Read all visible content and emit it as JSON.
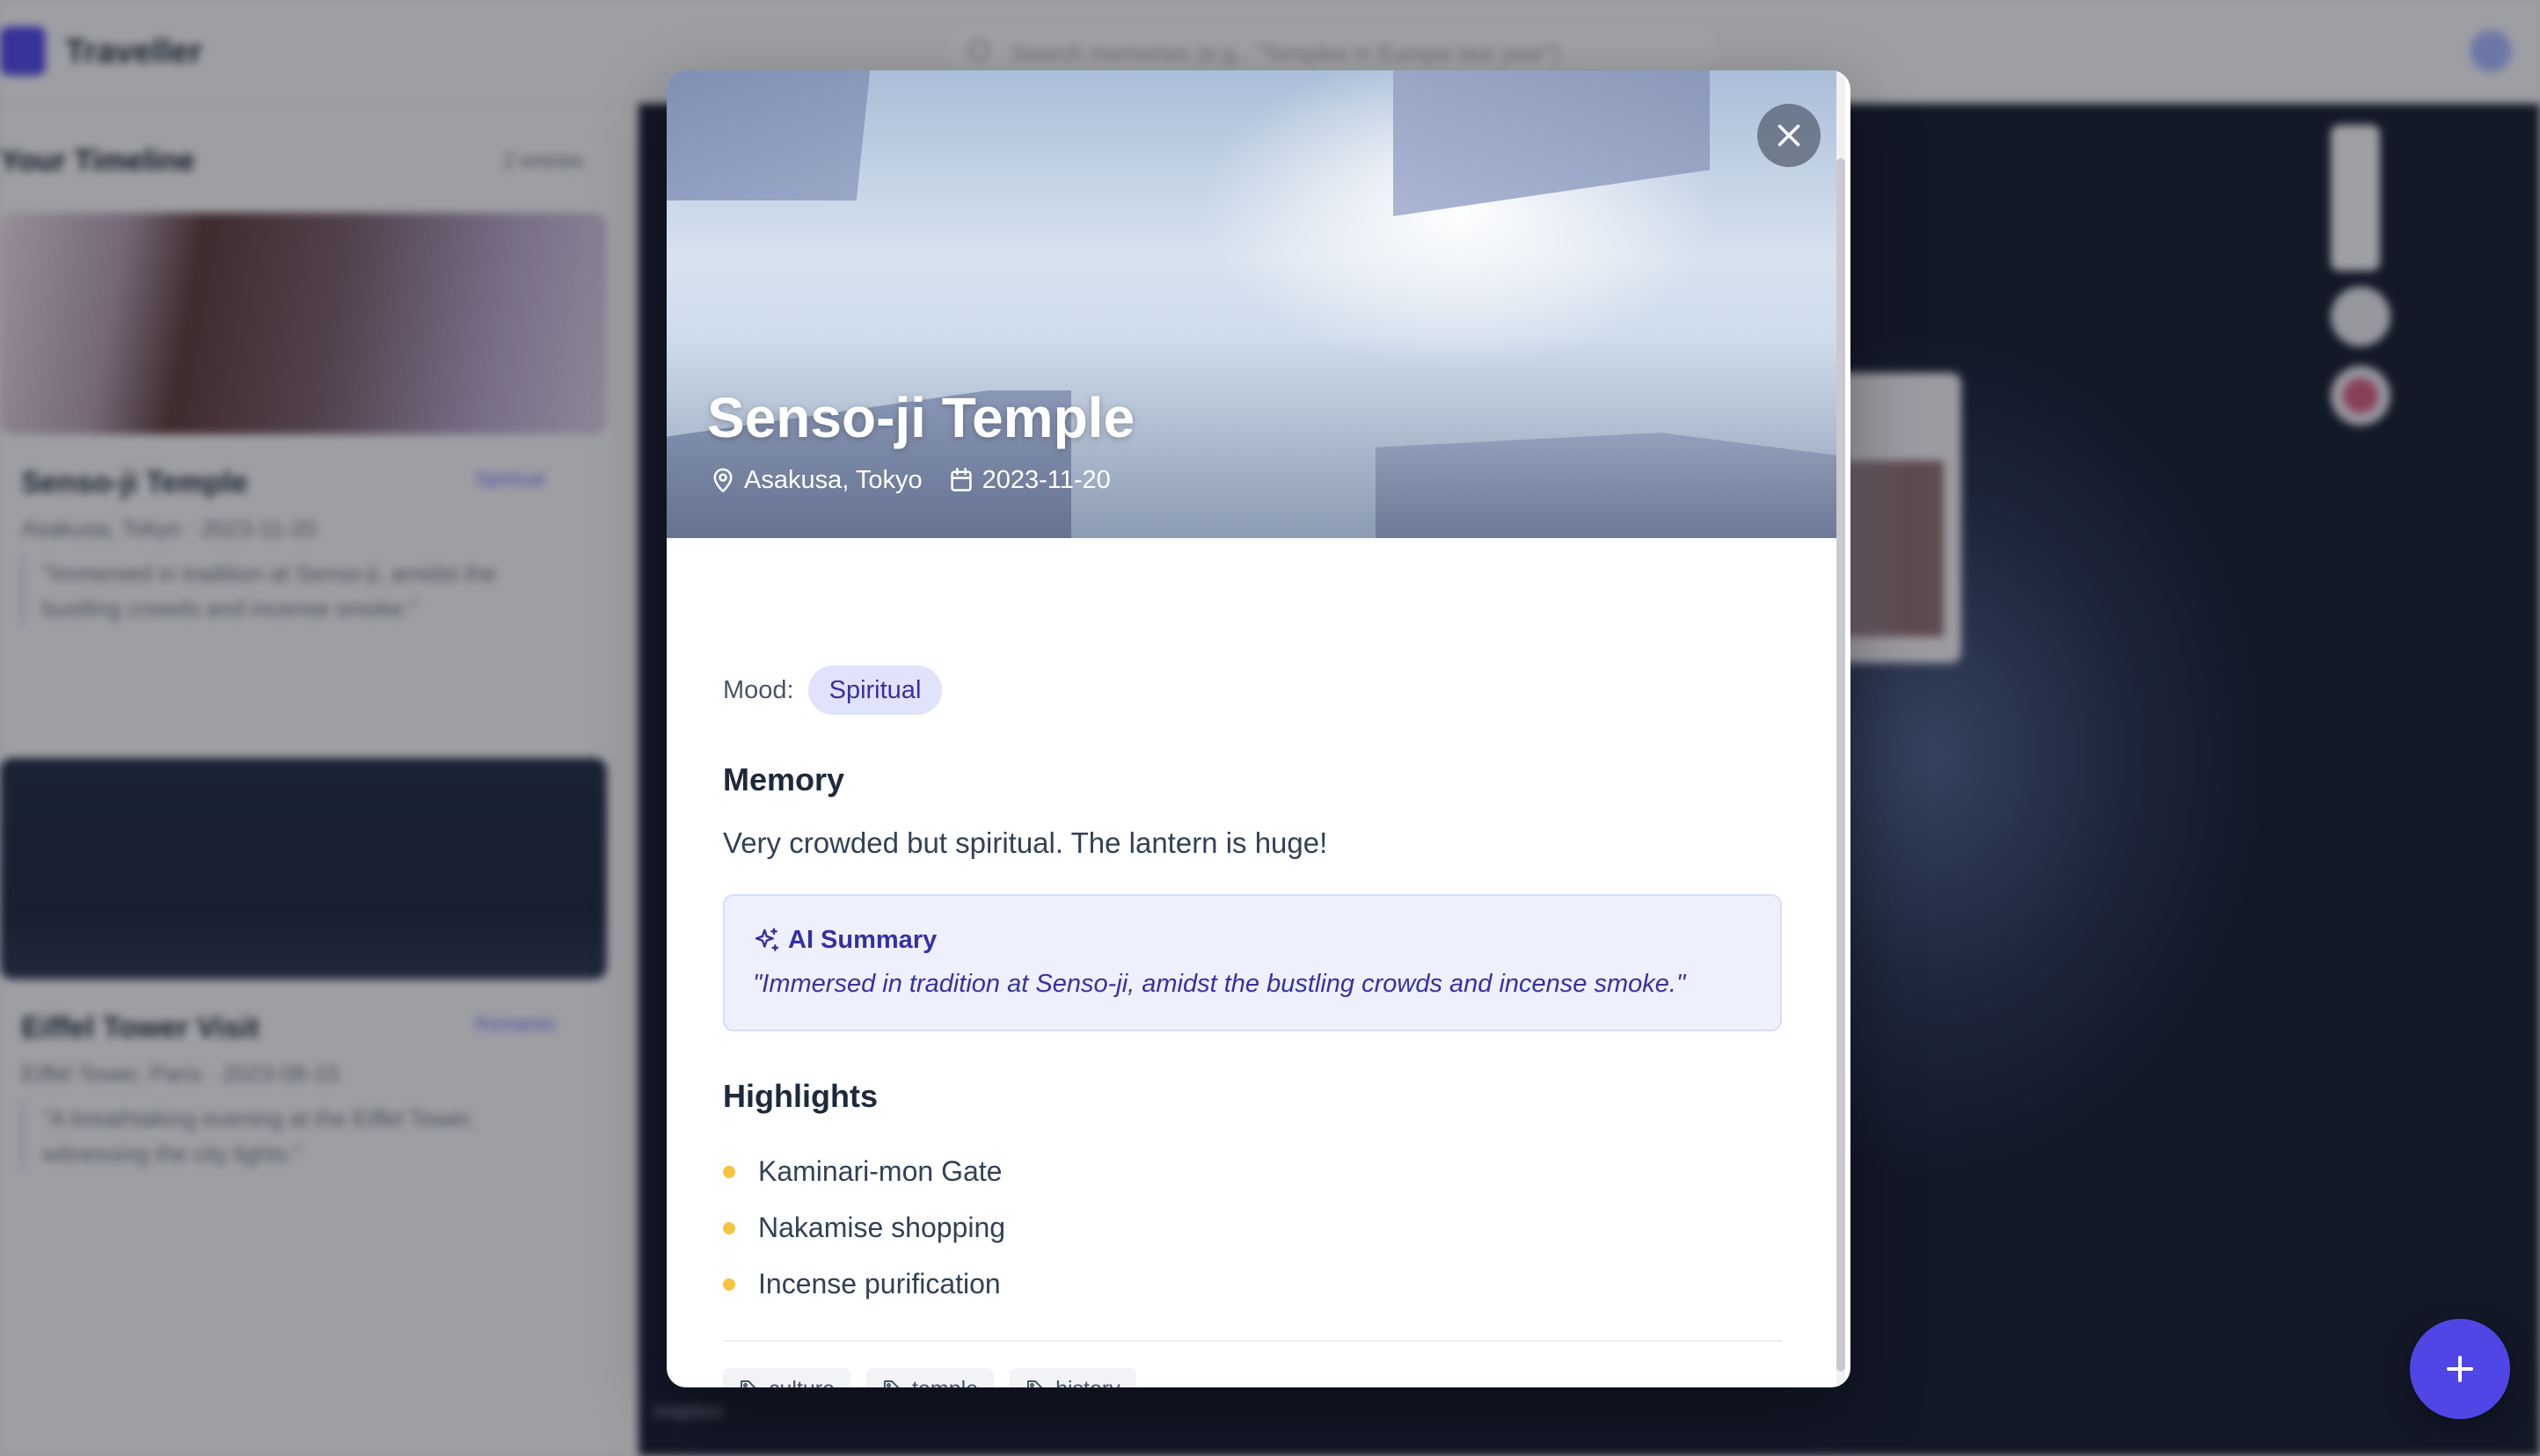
{
  "app": {
    "brand": "Traveller",
    "search_placeholder": "Search memories (e.g., \"Temples in Europe last year\")"
  },
  "sidebar": {
    "title": "Your Timeline",
    "filter_label": "2 entries",
    "cards": [
      {
        "title": "Senso-ji Temple",
        "mood": "Spiritual",
        "meta": "Asakusa, Tokyo  ·  2023-11-20",
        "quote": "\"Immersed in tradition at Senso-ji, amidst the bustling crowds and incense smoke.\""
      },
      {
        "title": "Eiffel Tower Visit",
        "mood": "Romantic",
        "meta": "Eiffel Tower, Paris  ·  2023-08-15",
        "quote": "\"A breathtaking evening at the Eiffel Tower, witnessing the city lights.\""
      }
    ]
  },
  "map": {
    "attribution": "mapbox"
  },
  "modal": {
    "title": "Senso-ji Temple",
    "location": "Asakusa, Tokyo",
    "date": "2023-11-20",
    "mood_label": "Mood:",
    "mood": "Spiritual",
    "memory_title": "Memory",
    "memory_text": "Very crowded but spiritual. The lantern is huge!",
    "ai_summary_title": "AI Summary",
    "ai_summary_text": "\"Immersed in tradition at Senso-ji, amidst the bustling crowds and incense smoke.\"",
    "highlights_title": "Highlights",
    "highlights": [
      "Kaminari-mon Gate",
      "Nakamise shopping",
      "Incense purification"
    ],
    "tags": [
      "culture",
      "temple",
      "history"
    ]
  },
  "colors": {
    "accent": "#4f46e5",
    "mood_chip_bg": "#e0e3fb",
    "mood_chip_text": "#3730a3",
    "ai_box_bg": "#eef0fd",
    "highlight_dot": "#f5c542"
  },
  "icons": {
    "close": "close-icon",
    "location": "map-pin-icon",
    "date": "calendar-icon",
    "ai": "sparkles-icon",
    "tag": "tag-icon",
    "fab": "plus-icon"
  }
}
